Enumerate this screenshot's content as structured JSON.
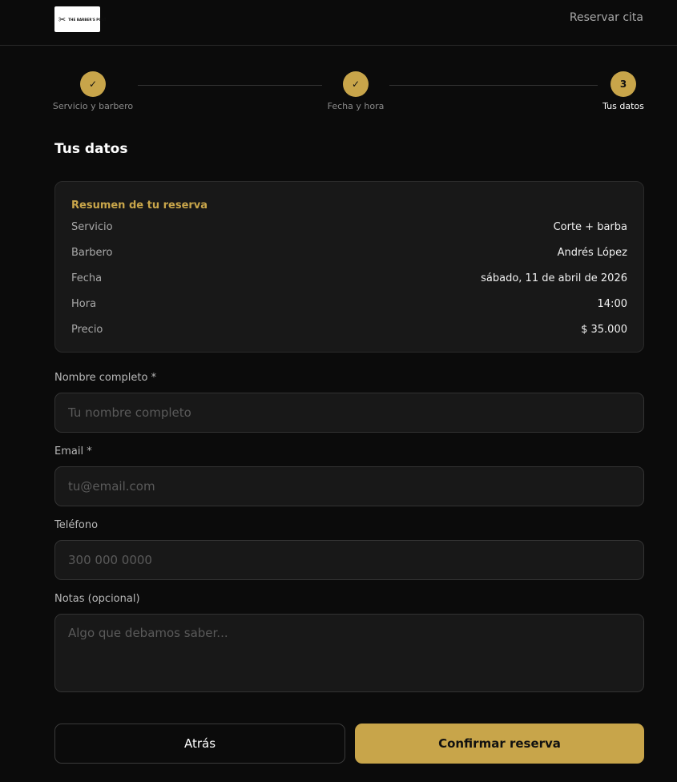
{
  "header": {
    "logo_text": "THE BARBER'S POST",
    "nav_link": "Reservar cita"
  },
  "stepper": {
    "steps": [
      {
        "label": "Servicio y barbero",
        "mark": "✓",
        "state": "done"
      },
      {
        "label": "Fecha y hora",
        "mark": "✓",
        "state": "done"
      },
      {
        "label": "Tus datos",
        "mark": "3",
        "state": "active"
      }
    ]
  },
  "section_title": "Tus datos",
  "summary": {
    "title": "Resumen de tu reserva",
    "rows": [
      {
        "label": "Servicio",
        "value": "Corte + barba"
      },
      {
        "label": "Barbero",
        "value": "Andrés López"
      },
      {
        "label": "Fecha",
        "value": "sábado, 11 de abril de 2026"
      },
      {
        "label": "Hora",
        "value": "14:00"
      },
      {
        "label": "Precio",
        "value": "$ 35.000"
      }
    ]
  },
  "form": {
    "name": {
      "label": "Nombre completo *",
      "placeholder": "Tu nombre completo",
      "value": ""
    },
    "email": {
      "label": "Email *",
      "placeholder": "tu@email.com",
      "value": ""
    },
    "phone": {
      "label": "Teléfono",
      "placeholder": "300 000 0000",
      "value": ""
    },
    "notes": {
      "label": "Notas (opcional)",
      "placeholder": "Algo que debamos saber...",
      "value": ""
    }
  },
  "actions": {
    "back_label": "Atrás",
    "confirm_label": "Confirmar reserva"
  },
  "colors": {
    "accent": "#c8a54a",
    "background": "#0b0b0b",
    "card": "#181818"
  }
}
